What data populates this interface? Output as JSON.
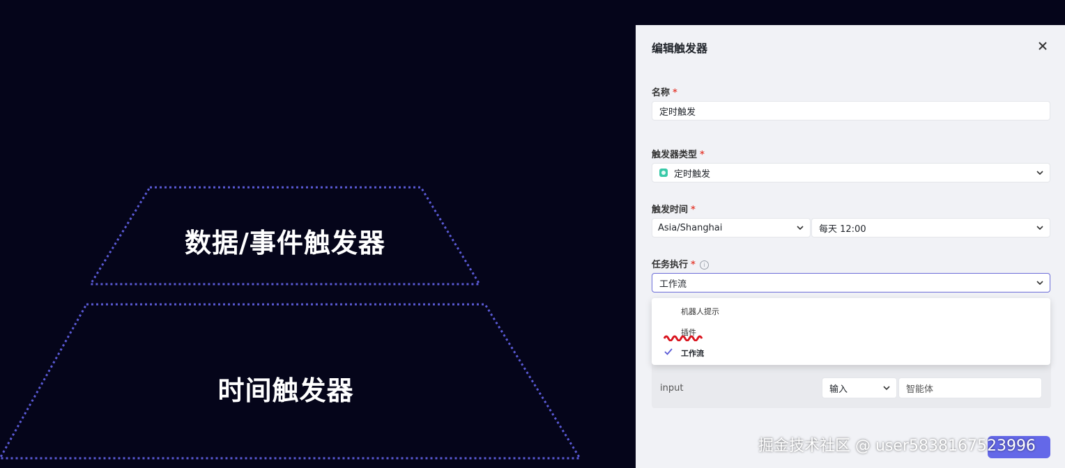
{
  "pyramid": {
    "top_tier_label": "数据/事件触发器",
    "bottom_tier_label": "时间触发器",
    "border_color": "#5a5ad6"
  },
  "panel": {
    "title": "编辑触发器",
    "close_icon": "close-icon",
    "name_field": {
      "label": "名称",
      "required_mark": "*",
      "value": "定时触发"
    },
    "trigger_type": {
      "label": "触发器类型",
      "required_mark": "*",
      "value": "定时触发",
      "icon": "clock-icon"
    },
    "trigger_time": {
      "label": "触发时间",
      "required_mark": "*",
      "timezone": "Asia/Shanghai",
      "schedule": "每天 12:00"
    },
    "task_execution": {
      "label": "任务执行",
      "required_mark": "*",
      "info_icon": "ⓘ",
      "value": "工作流",
      "options": [
        {
          "label": "机器人提示",
          "selected": false
        },
        {
          "label": "插件",
          "selected": false
        },
        {
          "label": "工作流",
          "selected": true
        }
      ]
    },
    "params": {
      "param_name": "input",
      "value_type": "输入",
      "value": "智能体"
    },
    "accent_color": "#6468e8"
  },
  "watermark": "掘金技术社区 @ user5838167523996"
}
